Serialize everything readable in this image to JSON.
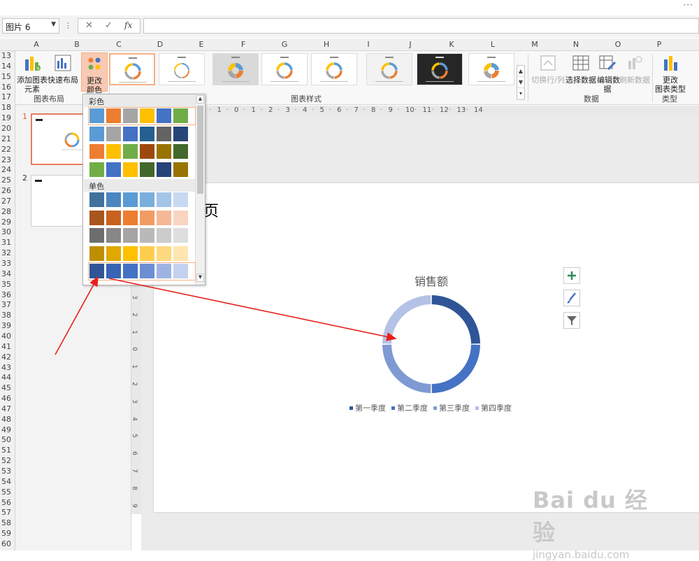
{
  "topbar": {
    "more_icon": "···"
  },
  "formula_bar": {
    "name_box": "图片 6",
    "cancel_glyph": "✕",
    "enter_glyph": "✓",
    "fx_glyph": "fx",
    "formula_value": ""
  },
  "columns": [
    "A",
    "B",
    "C",
    "D",
    "E",
    "F",
    "G",
    "H",
    "I",
    "J",
    "K",
    "L",
    "M",
    "N",
    "O",
    "P"
  ],
  "rows": [
    "13",
    "14",
    "15",
    "16",
    "17",
    "18",
    "19",
    "20",
    "21",
    "22",
    "23",
    "24",
    "25",
    "26",
    "27",
    "28",
    "29",
    "30",
    "31",
    "32",
    "33",
    "34",
    "35",
    "36",
    "37",
    "38",
    "39",
    "40",
    "41",
    "42",
    "43",
    "44",
    "45",
    "46",
    "47",
    "48",
    "49",
    "50",
    "51",
    "52",
    "53",
    "54",
    "55",
    "56",
    "57",
    "58",
    "59",
    "60"
  ],
  "ribbon": {
    "add_element": "添加图表\n元素",
    "quick_layout": "快速布局",
    "change_color": "更改\n颜色",
    "group_layout": "图表布局",
    "group_styles": "图表样式",
    "switch_row_col": "切换行/列",
    "select_data": "选择数据",
    "edit_data": "编辑数\n据",
    "refresh_data": "刷新数据",
    "group_data": "数据",
    "change_type": "更改\n图表类型",
    "group_type": "类型"
  },
  "slides": [
    {
      "number": "1"
    },
    {
      "number": "2"
    }
  ],
  "slide": {
    "title_fragment": "页"
  },
  "chart_data": {
    "type": "pie",
    "subtype": "doughnut",
    "title": "销售额",
    "categories": [
      "第一季度",
      "第二季度",
      "第三季度",
      "第四季度"
    ],
    "values": [
      25,
      25,
      25,
      25
    ],
    "colors": [
      "#2f5597",
      "#4472c4",
      "#7f9ad3",
      "#b4c2e5"
    ],
    "legend_position": "bottom"
  },
  "dropdown": {
    "section_colorful": "彩色",
    "section_mono": "单色",
    "colorful_rows": [
      [
        "#5b9bd5",
        "#ed7d31",
        "#a5a5a5",
        "#ffc000",
        "#4472c4",
        "#70ad47"
      ],
      [
        "#5b9bd5",
        "#a5a5a5",
        "#4472c4",
        "#255e91",
        "#636363",
        "#264478"
      ],
      [
        "#ed7d31",
        "#ffc000",
        "#70ad47",
        "#9e480e",
        "#997300",
        "#43682b"
      ],
      [
        "#70ad47",
        "#4472c4",
        "#ffc000",
        "#43682b",
        "#264478",
        "#997300"
      ]
    ],
    "mono_rows": [
      [
        "#41719c",
        "#4a87c1",
        "#5b9bd5",
        "#7aaedc",
        "#a3c5e8",
        "#c6d9f0"
      ],
      [
        "#a9551e",
        "#c9621f",
        "#ed7d31",
        "#f19c65",
        "#f5b895",
        "#f8d4c1"
      ],
      [
        "#6e6e6e",
        "#878787",
        "#a5a5a5",
        "#b9b9b9",
        "#cccccc",
        "#dedede"
      ],
      [
        "#bf8f00",
        "#e0a800",
        "#ffc000",
        "#ffcd4e",
        "#ffd97f",
        "#ffe6b1"
      ],
      [
        "#2f5597",
        "#3864b6",
        "#4472c4",
        "#6b8ed3",
        "#9fb3e2",
        "#c4d1ef"
      ]
    ]
  },
  "side_buttons": [
    "plus-icon",
    "brush-icon",
    "filter-icon"
  ],
  "watermark": {
    "logo": "Bai du 经验",
    "url": "jingyan.baidu.com"
  }
}
